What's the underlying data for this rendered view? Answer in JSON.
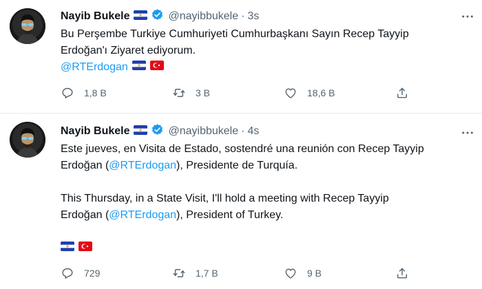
{
  "tweets": [
    {
      "name": "Nayib Bukele",
      "handle": "@nayibbukele",
      "separator": "·",
      "time": "3s",
      "line1": "Bu Perşembe Turkiye Cumhuriyeti Cumhurbaşkanı Sayın Recep Tayyip",
      "line2": "Erdoğan'ı Ziyaret ediyorum.",
      "mention": "@RTErdogan",
      "replies": "1,8 B",
      "retweets": "3 B",
      "likes": "18,6 B"
    },
    {
      "name": "Nayib Bukele",
      "handle": "@nayibbukele",
      "separator": "·",
      "time": "4s",
      "es_line1": "Este jueves, en Visita de Estado, sostendré una reunión con Recep Tayyip",
      "es_line2_pre": "Erdoğan (",
      "es_mention": "@RTErdogan",
      "es_line2_post": "), Presidente de Turquía.",
      "en_line1": "This Thursday, in a State Visit, I'll hold a meeting with Recep Tayyip",
      "en_line2_pre": "Erdoğan (",
      "en_mention": "@RTErdogan",
      "en_line2_post": "), President of Turkey.",
      "replies": "729",
      "retweets": "1,7 B",
      "likes": "9 B"
    }
  ],
  "icons": [
    "verified-badge-icon",
    "el-salvador-flag-icon",
    "turkey-flag-icon",
    "reply-icon",
    "retweet-icon",
    "like-icon",
    "share-icon",
    "more-icon"
  ],
  "colors": {
    "accent": "#1d9bf0",
    "muted": "#536471",
    "text": "#0f1419"
  }
}
